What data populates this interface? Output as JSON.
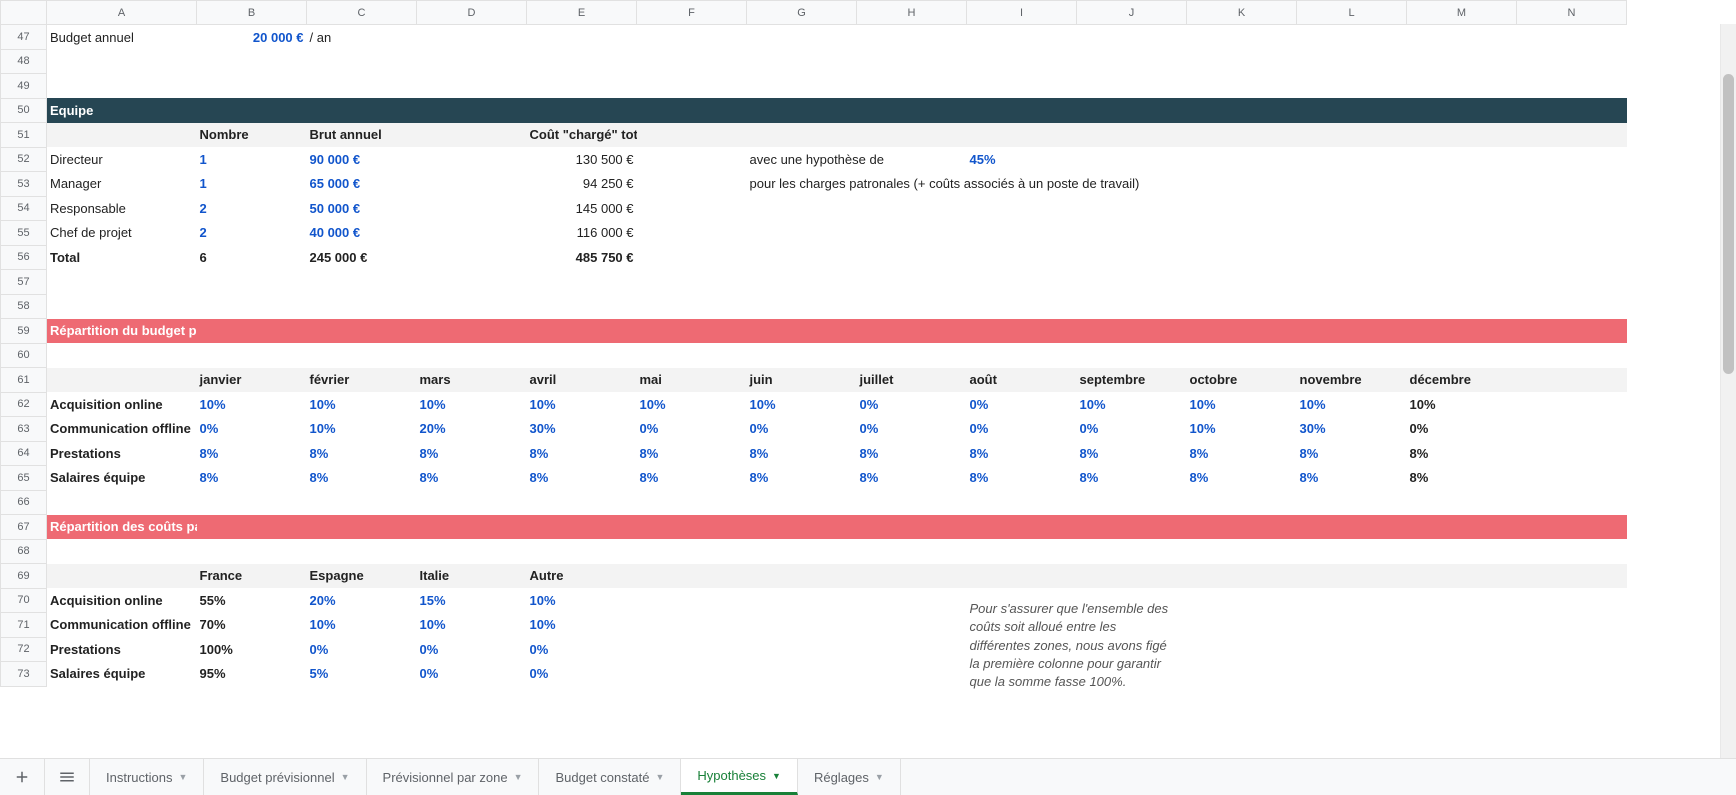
{
  "columns": [
    "",
    "A",
    "B",
    "C",
    "D",
    "E",
    "F",
    "G",
    "H",
    "I",
    "J",
    "K",
    "L",
    "M",
    "N"
  ],
  "row_numbers_start": 47,
  "row_numbers_end": 73,
  "budget": {
    "label": "Budget annuel",
    "value": "20 000 €",
    "unit": "/ an"
  },
  "equipe": {
    "header": "Equipe",
    "cols": {
      "nombre": "Nombre",
      "brut": "Brut annuel",
      "cout": "Coût \"chargé\" total"
    },
    "rows": [
      {
        "role": "Directeur",
        "n": "1",
        "brut": "90 000 €",
        "cout": "130 500 €"
      },
      {
        "role": "Manager",
        "n": "1",
        "brut": "65 000 €",
        "cout": "94 250 €"
      },
      {
        "role": "Responsable",
        "n": "2",
        "brut": "50 000 €",
        "cout": "145 000 €"
      },
      {
        "role": "Chef de projet",
        "n": "2",
        "brut": "40 000 €",
        "cout": "116 000 €"
      }
    ],
    "total": {
      "label": "Total",
      "n": "6",
      "brut": "245 000 €",
      "cout": "485 750 €"
    },
    "note1": "avec une hypothèse de",
    "pct": "45%",
    "note2": "pour les charges patronales (+ coûts associés à un poste de travail)"
  },
  "repartition_mois": {
    "header": "Répartition du budget par par mois",
    "months": [
      "janvier",
      "février",
      "mars",
      "avril",
      "mai",
      "juin",
      "juillet",
      "août",
      "septembre",
      "octobre",
      "novembre",
      "décembre"
    ],
    "rows": [
      {
        "label": "Acquisition online",
        "vals": [
          "10%",
          "10%",
          "10%",
          "10%",
          "10%",
          "10%",
          "0%",
          "0%",
          "10%",
          "10%",
          "10%",
          "10%"
        ],
        "last_black": true
      },
      {
        "label": "Communication offline",
        "vals": [
          "0%",
          "10%",
          "20%",
          "30%",
          "0%",
          "0%",
          "0%",
          "0%",
          "0%",
          "10%",
          "30%",
          "0%"
        ],
        "last_black": true
      },
      {
        "label": "Prestations",
        "vals": [
          "8%",
          "8%",
          "8%",
          "8%",
          "8%",
          "8%",
          "8%",
          "8%",
          "8%",
          "8%",
          "8%",
          "8%"
        ],
        "last_black": true
      },
      {
        "label": "Salaires équipe",
        "vals": [
          "8%",
          "8%",
          "8%",
          "8%",
          "8%",
          "8%",
          "8%",
          "8%",
          "8%",
          "8%",
          "8%",
          "8%"
        ],
        "last_black": true
      }
    ]
  },
  "repartition_pays": {
    "header": "Répartition des coûts par pays / filiale",
    "countries": [
      "France",
      "Espagne",
      "Italie",
      "Autre"
    ],
    "rows": [
      {
        "label": "Acquisition online",
        "vals": [
          "55%",
          "20%",
          "15%",
          "10%"
        ]
      },
      {
        "label": "Communication offline",
        "vals": [
          "70%",
          "10%",
          "10%",
          "10%"
        ]
      },
      {
        "label": "Prestations",
        "vals": [
          "100%",
          "0%",
          "0%",
          "0%"
        ]
      },
      {
        "label": "Salaires équipe",
        "vals": [
          "95%",
          "5%",
          "0%",
          "0%"
        ]
      }
    ],
    "note": "Pour s'assurer que l'ensemble des coûts soit alloué entre les différentes zones, nous avons figé la première colonne pour garantir que la somme fasse 100%."
  },
  "tabs": [
    "Instructions",
    "Budget prévisionnel",
    "Prévisionnel par zone",
    "Budget constaté",
    "Hypothèses",
    "Réglages"
  ],
  "active_tab": "Hypothèses"
}
